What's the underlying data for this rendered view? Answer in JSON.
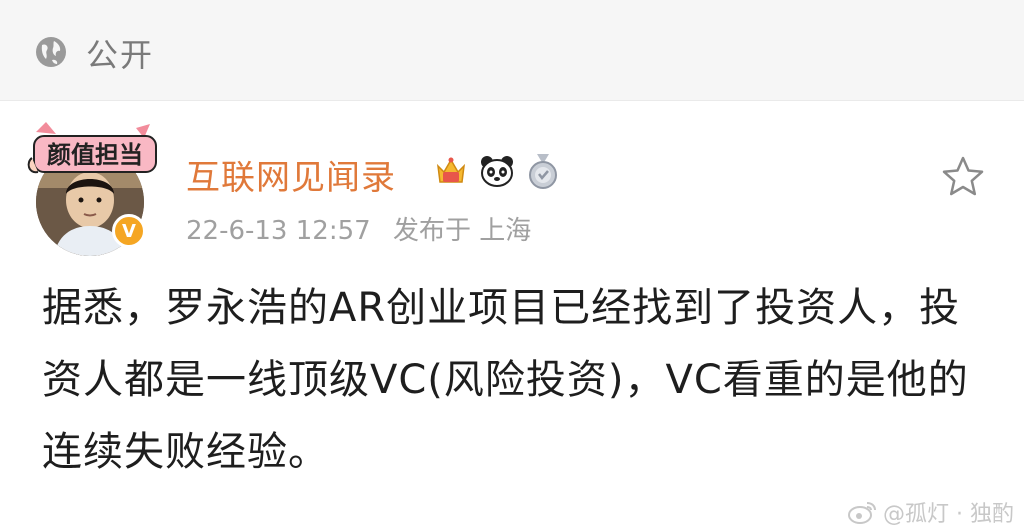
{
  "visibility": {
    "icon": "globe-icon",
    "label": "公开"
  },
  "author": {
    "name": "互联网见闻录",
    "avatar_sticker_text": "颜值担当",
    "verified_mark": "V",
    "badges": [
      "crown-badge-icon",
      "panda-badge-icon",
      "medal-badge-icon"
    ]
  },
  "meta": {
    "datetime": "22-6-13 12:57",
    "location": "发布于 上海"
  },
  "post": {
    "text": "据悉，罗永浩的AR创业项目已经找到了投资人，投资人都是一线顶级VC(风险投资)，VC看重的是他的连续失败经验。"
  },
  "watermark": {
    "text": "@孤灯 · 独酌"
  },
  "colors": {
    "username": "#e0793a",
    "meta": "#a0a0a0",
    "body_text": "#1e1e1e",
    "visibility_bar_bg": "#f6f6f6",
    "verified": "#f5a623"
  }
}
